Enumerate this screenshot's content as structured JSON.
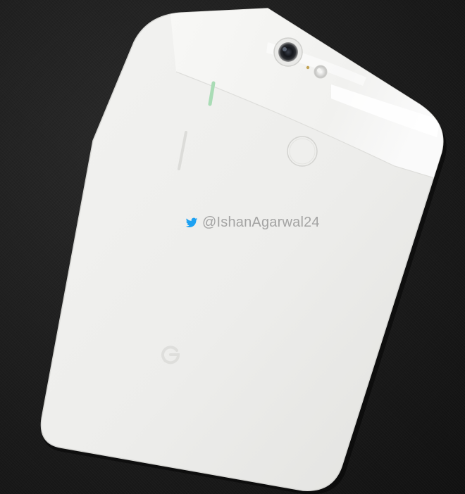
{
  "watermark": {
    "handle": "@IshanAgarwal24",
    "icon": "twitter-bird-icon",
    "icon_color": "#1da1f2"
  },
  "phone": {
    "body_color": "#eeeeec",
    "glass_color": "#f6f6f4",
    "side_button_color": "#a9dcb5",
    "logo": "google-g-logo"
  },
  "background": {
    "color": "#1b1b1b"
  }
}
